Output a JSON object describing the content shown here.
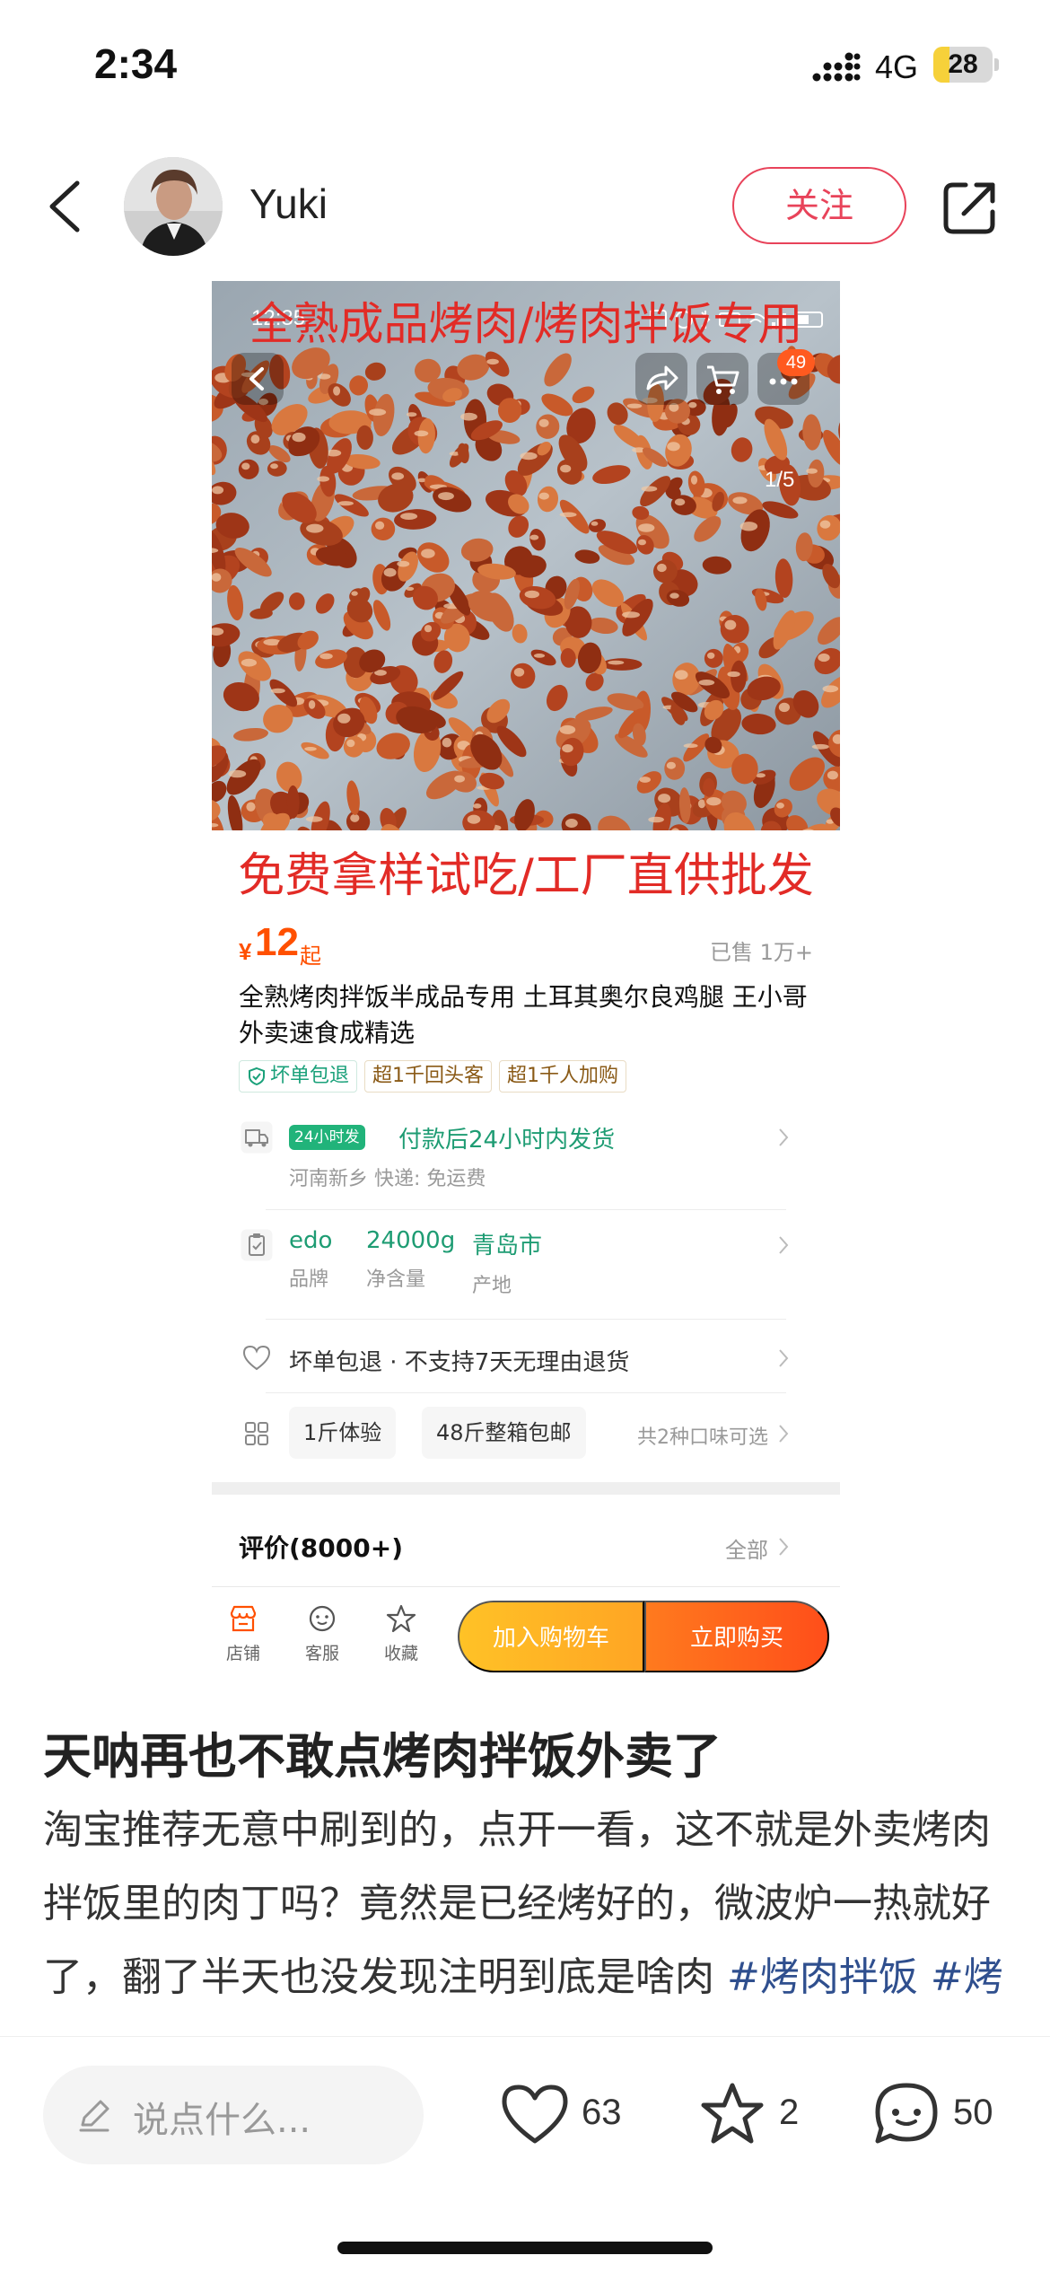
{
  "status_bar": {
    "time": "2:34",
    "network": "4G",
    "battery": 28,
    "battery_label": "28"
  },
  "post_header": {
    "author": "Yuki",
    "follow_label": "关注"
  },
  "product_screenshot": {
    "inner_time": "12:35",
    "photo_banner": "全熟成品烤肉/烤肉拌饭专用",
    "cart_badge": "49",
    "page_indicator": "1/5",
    "promo_banner": "免费拿样试吃/工厂直供批发",
    "price": {
      "symbol": "¥",
      "value": "12",
      "suffix": "起",
      "sold": "已售 1万+"
    },
    "title": "全熟烤肉拌饭半成品专用 土耳其奥尔良鸡腿 王小哥外卖速食成精选",
    "tags": [
      {
        "label": "坏单包退"
      },
      {
        "label": "超1千回头客"
      },
      {
        "label": "超1千人加购"
      }
    ],
    "shipping": {
      "badge": "24小时发",
      "text": "付款后24小时内发货",
      "sub": "河南新乡  快递: 免运费"
    },
    "attributes": [
      {
        "value": "edo",
        "label": "品牌"
      },
      {
        "value": "24000g",
        "label": "净含量"
      },
      {
        "value": "青岛市",
        "label": "产地"
      }
    ],
    "guarantee": "坏单包退 · 不支持7天无理由退货",
    "options": [
      {
        "label": "1斤体验"
      },
      {
        "label": "48斤整箱包邮"
      }
    ],
    "options_count": "共2种口味可选",
    "reviews": {
      "title": "评价(8000+)",
      "all": "全部"
    },
    "bottom_tabs": [
      {
        "label": "店铺"
      },
      {
        "label": "客服"
      },
      {
        "label": "收藏"
      }
    ],
    "add_to_cart": "加入购物车",
    "buy_now": "立即购买",
    "colors": {
      "accent": "#ff5000",
      "green": "#1e9c73",
      "red_text": "#e22b26"
    }
  },
  "post": {
    "title": "天呐再也不敢点烤肉拌饭外卖了",
    "body": "淘宝推荐无意中刷到的，点开一看，这不就是外卖烤肉拌饭里的肉丁吗？竟然是已经烤好的，微波炉一热就好了，翻了半天也没发现注明到底是啥肉 ",
    "hashtags": [
      "#烤肉拌饭",
      "#烤肉"
    ]
  },
  "bottom_bar": {
    "comment_placeholder": "说点什么...",
    "likes": "63",
    "stars": "2",
    "comments": "50"
  },
  "icons": {
    "back": "chevron-left-icon",
    "share": "share-icon",
    "like": "heart-icon",
    "collect": "star-icon",
    "comment": "chat-bubble-icon",
    "edit": "pencil-icon"
  },
  "colors": {
    "follow": "#e8435a",
    "hashtag": "#2f4f8e",
    "battery_fill": "#f6d13a"
  }
}
